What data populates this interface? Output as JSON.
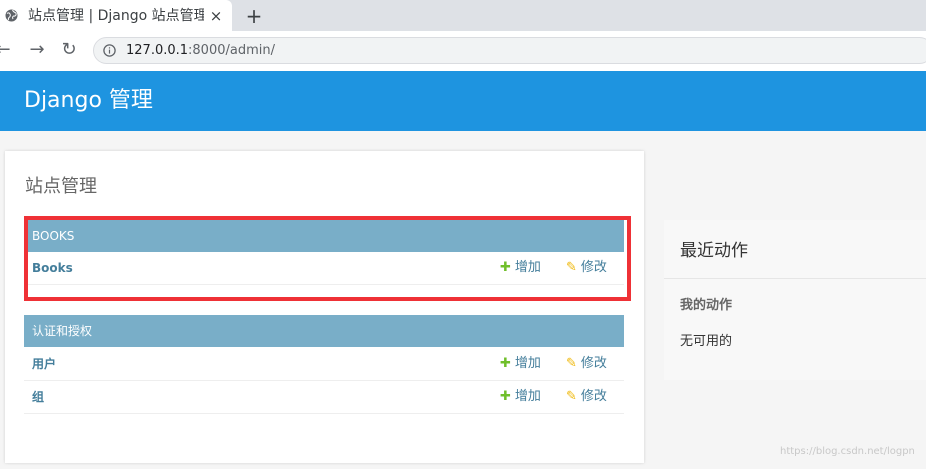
{
  "browser": {
    "tab_title": "站点管理 | Django 站点管理",
    "tab_close": "×",
    "new_tab": "+",
    "url_host": "127.0.0.1",
    "url_path": ":8000/admin/",
    "back_glyph": "←",
    "forward_glyph": "→",
    "reload_glyph": "↻",
    "icons": [
      "globe-icon",
      "info-icon"
    ]
  },
  "header": {
    "brand": "Django 管理"
  },
  "main": {
    "title": "站点管理",
    "modules": [
      {
        "caption": "BOOKS",
        "rows": [
          {
            "name": "Books",
            "add": "增加",
            "change": "修改"
          }
        ]
      },
      {
        "caption": "认证和授权",
        "rows": [
          {
            "name": "用户",
            "add": "增加",
            "change": "修改"
          },
          {
            "name": "组",
            "add": "增加",
            "change": "修改"
          }
        ]
      }
    ],
    "glyphs": {
      "plus": "✚",
      "pencil": "✎"
    }
  },
  "recent": {
    "title": "最近动作",
    "my_actions": "我的动作",
    "none": "无可用的"
  },
  "watermark": "https://blog.csdn.net/logpn",
  "colors": {
    "header": "#1e94e0",
    "caption": "#79aec8",
    "link": "#447e9b",
    "add": "#70bf2b",
    "change": "#efb80b",
    "highlight": "#ef3136"
  }
}
